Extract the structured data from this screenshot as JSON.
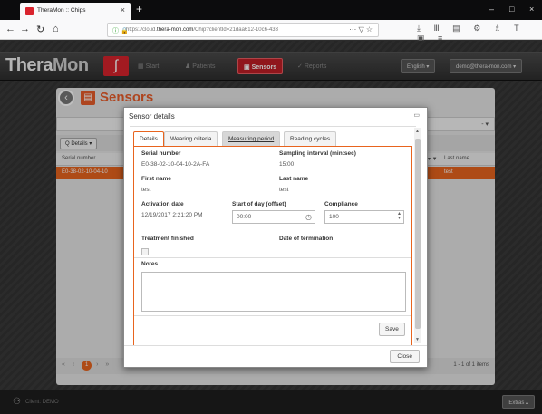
{
  "browser": {
    "tab_title": "TheraMon :: Chips",
    "tab_close": "×",
    "new_tab": "+",
    "url_prefix": "https://cloud.",
    "url_host": "thera-mon.com",
    "url_path": "/Chip?clientId=21daa612-10c6-433",
    "url_more": "··· ▽ ☆",
    "window_controls": {
      "minimize": "–",
      "maximize": "□",
      "close": "×"
    },
    "toolbar_icons": "⤓ Ⅲ ▤ ⚙ ♗ T ▣ ≡"
  },
  "app": {
    "logo_thera": "Thera",
    "logo_mon": "Mon",
    "menu": [
      {
        "label": "Start",
        "icon": "home-icon",
        "glyph": "▦"
      },
      {
        "label": "Patients",
        "icon": "patients-icon",
        "glyph": "♟"
      },
      {
        "label": "Sensors",
        "icon": "sensors-icon",
        "glyph": "▣"
      },
      {
        "label": "Reports",
        "icon": "reports-icon",
        "glyph": "✓"
      }
    ],
    "language_button": "English ▾",
    "user_button": "demo@thera-mon.com ▾",
    "page_title": "Sensors",
    "grid_toolbar_button": "Q Details ▾",
    "grid_columns": {
      "serial": "Serial number",
      "last_name": "Last name"
    },
    "grid_row": {
      "serial": "E0-38-02-10-04-10",
      "last_name": "test"
    },
    "pager_current": "1",
    "page_info": "1 - 1 of 1 items",
    "client_label": "Client: DEMO",
    "extras_button": "Extras ▴"
  },
  "modal": {
    "title": "Sensor details",
    "tabs": [
      "Details",
      "Wearing criteria",
      "Measuring period",
      "Reading cycles"
    ],
    "active_tab": 0,
    "fields": {
      "serial_label": "Serial number",
      "serial_value": "E0-38-02-10-04-10-2A-FA",
      "interval_label": "Sampling interval (min:sec)",
      "interval_value": "15:00",
      "first_name_label": "First name",
      "first_name_value": "test",
      "last_name_label": "Last name",
      "last_name_value": "test",
      "activation_label": "Activation date",
      "activation_value": "12/19/2017 2:21:20 PM",
      "start_of_day_label": "Start of day (offset)",
      "start_of_day_value": "00:00",
      "compliance_label": "Compliance",
      "compliance_value": "100",
      "treatment_label": "Treatment finished",
      "termination_label": "Date of termination",
      "notes_label": "Notes"
    },
    "save_button": "Save",
    "close_button": "Close"
  },
  "colors": {
    "accent": "#e8641e",
    "brand_red": "#d9232d",
    "active_menu": "#c01e26"
  }
}
